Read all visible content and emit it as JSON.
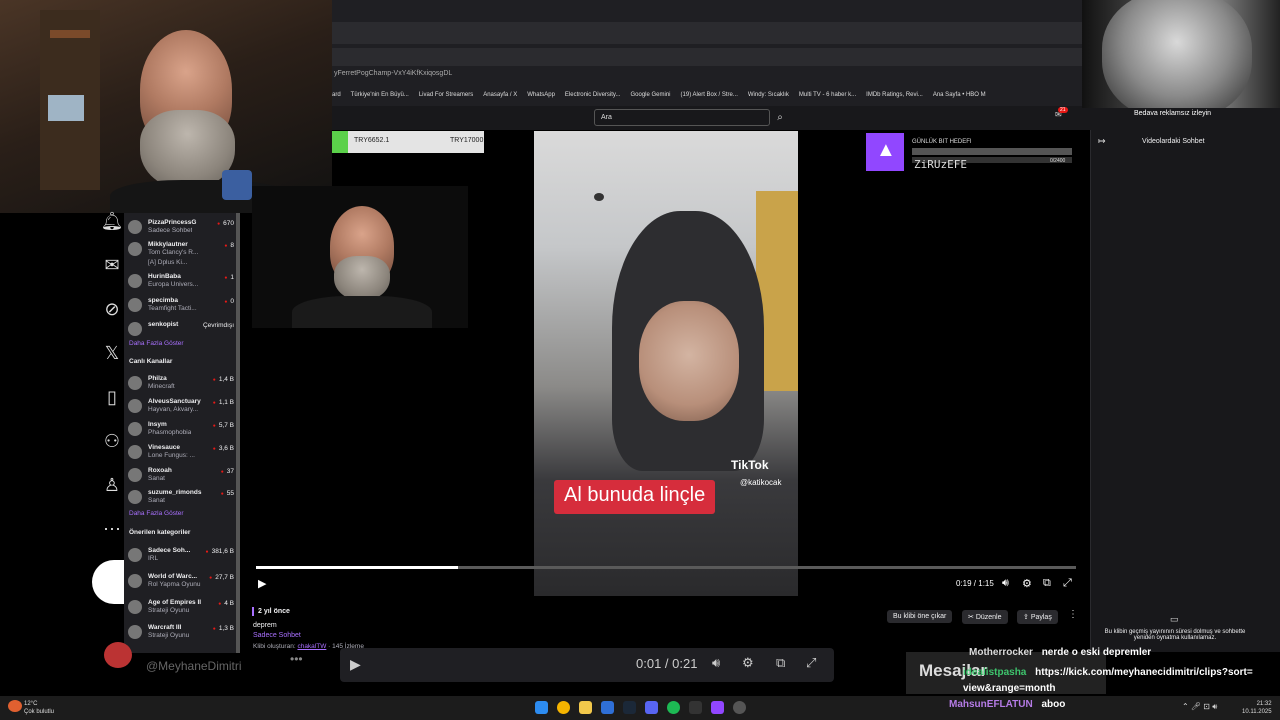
{
  "browser": {
    "url_fragment": "yFerretPogChamp-VxY4iKfKxiqosgDL",
    "bookmarks": [
      "ard",
      "Türkiye'nin En Büyü...",
      "Livad For Streamers",
      "Anasayfa / X",
      "WhatsApp",
      "Electronic Diversity...",
      "Google Gemini",
      "(19) Alert Box / Stre...",
      "Windy: Sıcaklık",
      "Multi TV - 6 haber k...",
      "IMDb Ratings, Revi...",
      "Ana Sayfa • HBO M"
    ]
  },
  "twitch_header": {
    "search_placeholder": "Ara",
    "notification_count": "21",
    "ad_free_label": "Bedava reklamsız izleyin"
  },
  "sidebar": {
    "followed": [
      {
        "name": "PizzaPrincessG",
        "sub": "Sadece Sohbet",
        "count": "670"
      },
      {
        "name": "Mikkylautner",
        "sub": "Tom Clancy's R...",
        "count": "8",
        "extra": "[A] Dplus Ki..."
      },
      {
        "name": "HurinBaba",
        "sub": "Europa Univers...",
        "count": "1"
      },
      {
        "name": "specimba",
        "sub": "Teamfight Tacti...",
        "count": "0"
      },
      {
        "name": "senkopist",
        "sub": "",
        "count": "Çevrimdışı",
        "offline": true
      }
    ],
    "show_more_1": "Daha Fazla Göster",
    "live_heading": "Canlı Kanallar",
    "live": [
      {
        "name": "Philza",
        "sub": "Minecraft",
        "count": "1,4 B"
      },
      {
        "name": "AlveusSanctuary",
        "sub": "Hayvan, Akvary...",
        "count": "1,1 B"
      },
      {
        "name": "Insym",
        "sub": "Phasmophobia",
        "count": "5,7 B"
      },
      {
        "name": "Vinesauce",
        "sub": "Lone Fungus: ...",
        "count": "3,6 B"
      },
      {
        "name": "Roxoah",
        "sub": "Sanat",
        "count": "37"
      },
      {
        "name": "suzume_rimonds",
        "sub": "Sanat",
        "count": "55"
      }
    ],
    "show_more_2": "Daha Fazla Göster",
    "rec_heading": "Önerilen kategoriler",
    "categories": [
      {
        "name": "Sadece Soh...",
        "sub": "IRL",
        "count": "381,6 B"
      },
      {
        "name": "World of Warc...",
        "sub": "Rol Yapma Oyunu",
        "count": "27,7 B"
      },
      {
        "name": "Age of Empires II",
        "sub": "Strateji Oyunu",
        "count": "4 B"
      },
      {
        "name": "Warcraft III",
        "sub": "Strateji Oyunu",
        "count": "1,3 B"
      }
    ]
  },
  "donation_bar": {
    "current": "TRY6652.1",
    "target": "TRY17000",
    "fraction": 0.39
  },
  "goal": {
    "title": "GÜNLÜK BIT HEDEFI",
    "name": "ZiRUzEFE",
    "count": "0/2400",
    "fraction": 0
  },
  "video": {
    "caption": "Al bunuda linçle",
    "tiktok": "TikTok",
    "tiktok_user": "@katikocak",
    "time": "0:19 / 1:15",
    "progress": 0.246
  },
  "clip": {
    "age": "2 yıl önce",
    "title": "deprem",
    "category": "Sadece Sohbet",
    "created_by_label": "Klibi oluşturan:",
    "creator": "chakalTW",
    "views": "· 145 İzleme",
    "feature_btn": "Bu klibi öne çıkar",
    "edit_btn": "Düzenle",
    "share_btn": "Paylaş"
  },
  "chat_panel": {
    "heading": "Videolardaki Sohbet",
    "expired": "Bu klibin geçmiş yayınının süresi dolmuş ve sohbette yeniden oynatma kullanılamaz."
  },
  "overlay": {
    "bottom_player_time": "0:01 / 0:21",
    "channel_handle": "@MeyhaneDimitri",
    "mesaj": "Mesajlar",
    "chat": [
      {
        "user": "Motherrocker",
        "color": "#dcdcdc",
        "text": "nerde o eski depremler"
      },
      {
        "user": "idealistpasha",
        "color": "#3ec46d",
        "text": "https://kick.com/meyhanecidimitri/clips?sort=view&range=month"
      },
      {
        "user": "MahsunEFLATUN",
        "color": "#b57be6",
        "text": "aboo"
      }
    ]
  },
  "taskbar": {
    "weather_temp": "12°C",
    "weather_desc": "Çok bulutlu",
    "time": "21:32",
    "date": "10.11.2025"
  }
}
